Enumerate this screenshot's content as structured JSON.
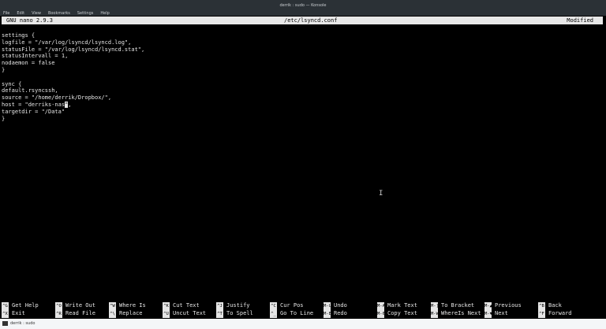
{
  "window": {
    "title": "derrik : sudo — Konsole",
    "menu": [
      "File",
      "Edit",
      "View",
      "Bookmarks",
      "Settings",
      "Help"
    ]
  },
  "nano": {
    "version": "GNU nano 2.9.3",
    "filename": "/etc/lsyncd.conf",
    "status": "Modified"
  },
  "editor": {
    "lines_before_cursor": "settings {\nlogfile = \"/var/log/lsyncd/lsyncd.log\",\nstatusFile = \"/var/log/lsyncd/lsyncd.stat\",\nstatusIntervall = 1,\nnodaemon = false\n}\n\nsync {\ndefault.rsyncssh,\nsource = \"/home/derrik/Dropbox/\",\nhost = \"derriks-nas",
    "cursor_char": "\"",
    "lines_after_cursor": ",\ntargetdir = \"/Data\"\n}"
  },
  "shortcuts": [
    {
      "key": "^G",
      "label": "Get Help"
    },
    {
      "key": "^O",
      "label": "Write Out"
    },
    {
      "key": "^W",
      "label": "Where Is"
    },
    {
      "key": "^K",
      "label": "Cut Text"
    },
    {
      "key": "^J",
      "label": "Justify"
    },
    {
      "key": "^C",
      "label": "Cur Pos"
    },
    {
      "key": "M-U",
      "label": "Undo"
    },
    {
      "key": "M-A",
      "label": "Mark Text"
    },
    {
      "key": "M-]",
      "label": "To Bracket"
    },
    {
      "key": "M-▲",
      "label": "Previous"
    },
    {
      "key": "^B",
      "label": "Back"
    },
    {
      "key": "^X",
      "label": "Exit"
    },
    {
      "key": "^R",
      "label": "Read File"
    },
    {
      "key": "^\\",
      "label": "Replace"
    },
    {
      "key": "^U",
      "label": "Uncut Text"
    },
    {
      "key": "^T",
      "label": "To Spell"
    },
    {
      "key": "^_",
      "label": "Go To Line"
    },
    {
      "key": "M-E",
      "label": "Redo"
    },
    {
      "key": "M-6",
      "label": "Copy Text"
    },
    {
      "key": "M-W",
      "label": "WhereIs Next"
    },
    {
      "key": "M-▼",
      "label": "Next"
    },
    {
      "key": "^F",
      "label": "Forward"
    }
  ],
  "taskbar": {
    "item": "derrik : sudo"
  }
}
